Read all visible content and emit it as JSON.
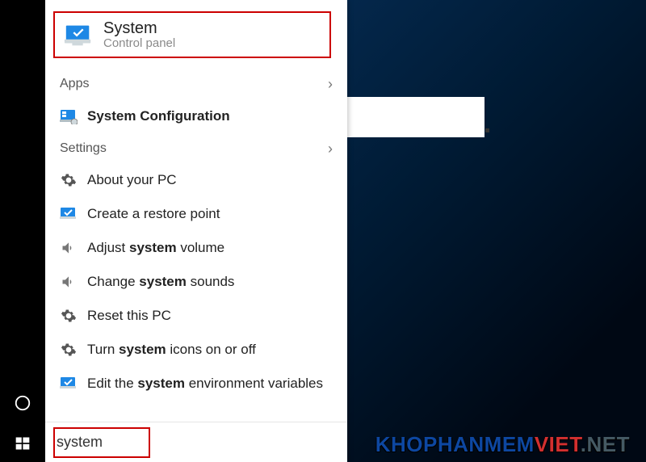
{
  "best_match": {
    "title": "System",
    "subtitle": "Control panel"
  },
  "sections": {
    "apps_label": "Apps",
    "settings_label": "Settings"
  },
  "apps": {
    "sysconf": "System Configuration"
  },
  "settings": {
    "about": "About your PC",
    "restore": "Create a restore point",
    "volume_pre": "Adjust ",
    "volume_bold": "system",
    "volume_post": " volume",
    "sounds_pre": "Change ",
    "sounds_bold": "system",
    "sounds_post": " sounds",
    "reset": "Reset this PC",
    "icons_pre": "Turn ",
    "icons_bold": "system",
    "icons_post": " icons on or off",
    "env_pre": "Edit the ",
    "env_bold": "system",
    "env_post": " environment variables"
  },
  "search": {
    "value": "system"
  },
  "watermark": {
    "a": "khophanmem",
    "b": "viet",
    "c": ".net"
  }
}
